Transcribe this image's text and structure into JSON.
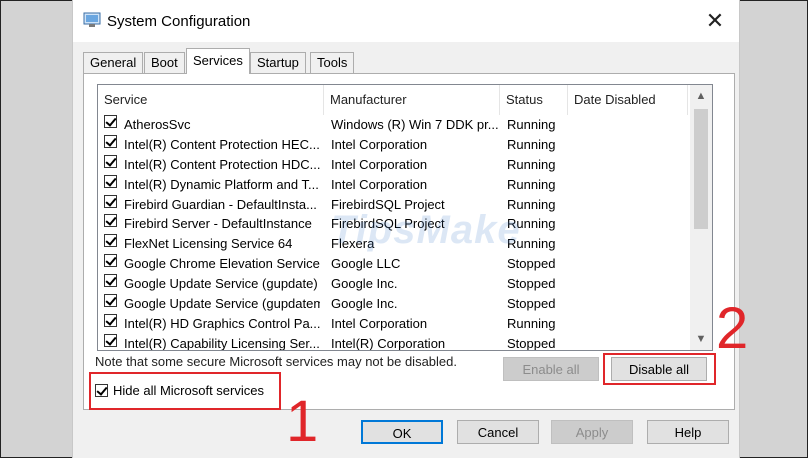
{
  "window": {
    "title": "System Configuration",
    "close_glyph": "✕"
  },
  "tabs": [
    {
      "label": "General"
    },
    {
      "label": "Boot"
    },
    {
      "label": "Services"
    },
    {
      "label": "Startup"
    },
    {
      "label": "Tools"
    }
  ],
  "columns": {
    "service": "Service",
    "manufacturer": "Manufacturer",
    "status": "Status",
    "date_disabled": "Date Disabled"
  },
  "services": [
    {
      "name": "AtherosSvc",
      "manufacturer": "Windows (R) Win 7 DDK pr...",
      "status": "Running"
    },
    {
      "name": "Intel(R) Content Protection HEC...",
      "manufacturer": "Intel Corporation",
      "status": "Running"
    },
    {
      "name": "Intel(R) Content Protection HDC...",
      "manufacturer": "Intel Corporation",
      "status": "Running"
    },
    {
      "name": "Intel(R) Dynamic Platform and T...",
      "manufacturer": "Intel Corporation",
      "status": "Running"
    },
    {
      "name": "Firebird Guardian - DefaultInsta...",
      "manufacturer": "FirebirdSQL Project",
      "status": "Running"
    },
    {
      "name": "Firebird Server - DefaultInstance",
      "manufacturer": "FirebirdSQL Project",
      "status": "Running"
    },
    {
      "name": "FlexNet Licensing Service 64",
      "manufacturer": "Flexera",
      "status": "Running"
    },
    {
      "name": "Google Chrome Elevation Service",
      "manufacturer": "Google LLC",
      "status": "Stopped"
    },
    {
      "name": "Google Update Service (gupdate)",
      "manufacturer": "Google Inc.",
      "status": "Stopped"
    },
    {
      "name": "Google Update Service (gupdatem)",
      "manufacturer": "Google Inc.",
      "status": "Stopped"
    },
    {
      "name": "Intel(R) HD Graphics Control Pa...",
      "manufacturer": "Intel Corporation",
      "status": "Running"
    },
    {
      "name": "Intel(R) Capability Licensing Ser...",
      "manufacturer": "Intel(R) Corporation",
      "status": "Stopped"
    }
  ],
  "scroll": {
    "up_glyph": "▲",
    "down_glyph": "▼"
  },
  "note": "Note that some secure Microsoft services may not be disabled.",
  "buttons": {
    "enable_all": "Enable all",
    "disable_all": "Disable all",
    "ok": "OK",
    "cancel": "Cancel",
    "apply": "Apply",
    "help": "Help"
  },
  "hide_ms": {
    "label": "Hide all Microsoft services",
    "checked": true
  },
  "annotations": {
    "step1": "1",
    "step2": "2",
    "highlight_color": "#e0262a"
  },
  "watermark": "TipsMake"
}
